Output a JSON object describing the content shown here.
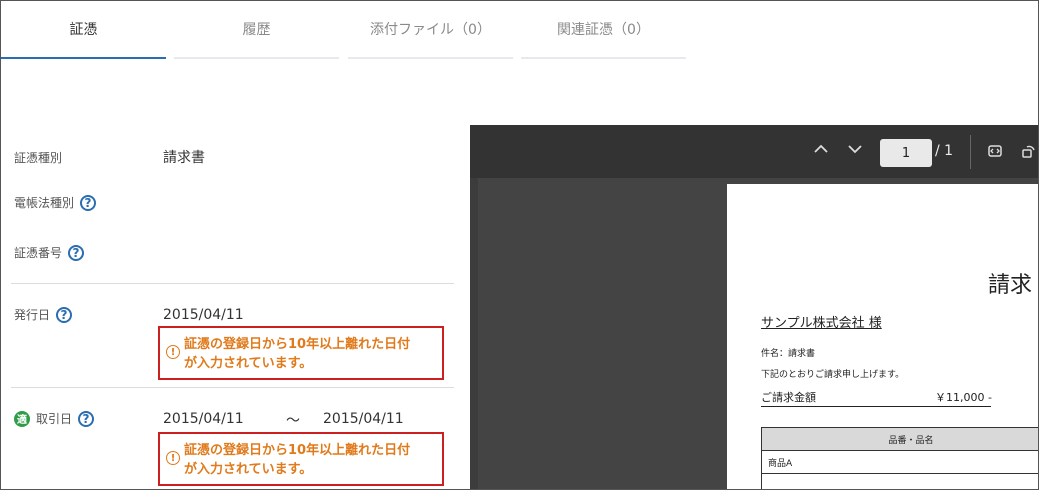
{
  "tabs": [
    {
      "label": "証憑",
      "active": true
    },
    {
      "label": "履歴"
    },
    {
      "label": "添付ファイル（0）"
    },
    {
      "label": "関連証憑（0）"
    }
  ],
  "form": {
    "type_label": "証憑種別",
    "type_value": "請求書",
    "ebook_label": "電帳法種別",
    "number_label": "証憑番号",
    "issue_label": "発行日",
    "issue_value": "2015/04/11",
    "issue_warning_line1": "証憑の登録日から10年以上離れた日付",
    "issue_warning_line2": "が入力されています。",
    "trade_badge": "適",
    "trade_label": "取引日",
    "trade_from": "2015/04/11",
    "trade_sep": "～",
    "trade_to": "2015/04/11",
    "trade_warning_line1": "証憑の登録日から10年以上離れた日付",
    "trade_warning_line2": "が入力されています。",
    "help_glyph": "?",
    "warn_glyph": "!"
  },
  "viewer": {
    "page_current": "1",
    "page_total": "/ 1",
    "prev_icon": "chevron-up-icon",
    "next_icon": "chevron-down-icon",
    "fit_icon": "fit-page-icon",
    "rotate_icon": "rotate-icon",
    "doc": {
      "title": "請求",
      "company": "サンプル株式会社 様",
      "subject": "件名：請求書",
      "note": "下記のとおりご請求申し上げます。",
      "amount_label": "ご請求金額",
      "amount_value": "￥11,000 -",
      "col_header": "品番・品名",
      "row1": "商品A"
    }
  },
  "colors": {
    "accent": "#2a6db0",
    "warning_text": "#e07a1b",
    "warning_border": "#cc1f1f",
    "badge": "#2e9d47"
  }
}
